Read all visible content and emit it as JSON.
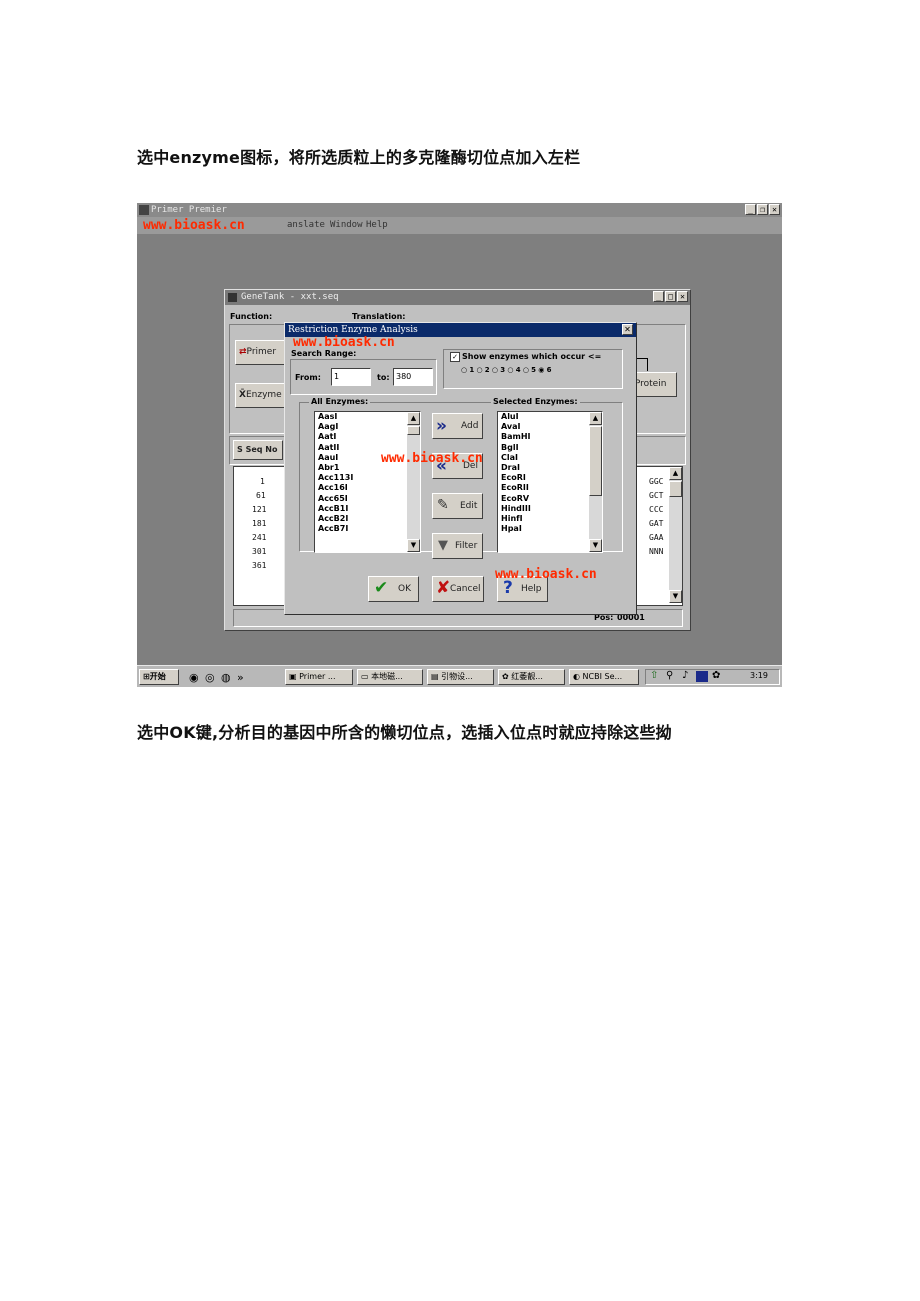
{
  "caption_top": "选中enzyme图标，将所选质粒上的多克隆酶切位点加入左栏",
  "caption_bottom": "选中OK键,分析目的基因中所含的懒切位点，选插入位点时就应持除这些拗",
  "watermark": "www.bioask.cn",
  "app": {
    "title": "Primer Premier",
    "menu": [
      "anslate",
      "Window",
      "Help"
    ]
  },
  "genetank": {
    "title": "GeneTank - xxt.seq",
    "function_label": "Function:",
    "translation_label": "Translation:",
    "primer_button": "Primer",
    "enzyme_button": "Enzyme",
    "protein_button": "Protein",
    "seq_button": "Seq No",
    "line_numbers": [
      "1",
      "61",
      "121",
      "181",
      "241",
      "301",
      "361"
    ],
    "seq_tails": [
      "GGC",
      "GCT",
      "CCC",
      "GAT",
      "GAA",
      "NNN"
    ],
    "pos_label": "Pos:",
    "pos_value": "00001"
  },
  "dialog": {
    "title": "Restriction Enzyme Analysis",
    "search_range_label": "Search Range:",
    "from_label": "From:",
    "from_value": "1",
    "to_label": "to:",
    "to_value": "380",
    "show_label": "Show enzymes which occur <=",
    "radio_options": [
      "1",
      "2",
      "3",
      "4",
      "5",
      "6"
    ],
    "radio_selected": "6",
    "all_label": "All Enzymes:",
    "selected_label": "Selected Enzymes:",
    "all_enzymes": [
      "AasI",
      "AagI",
      "AatI",
      "AatII",
      "AauI",
      "Abr1",
      "Acc113I",
      "Acc16I",
      "Acc65I",
      "AccB1I",
      "AccB2I",
      "AccB7I"
    ],
    "selected_enzymes": [
      "AluI",
      "AvaI",
      "BamHI",
      "BglI",
      "ClaI",
      "DraI",
      "EcoRI",
      "EcoRII",
      "EcoRV",
      "HindIII",
      "HinfI",
      "HpaI"
    ],
    "add_button": "Add",
    "del_button": "Del",
    "edit_button": "Edit",
    "filter_button": "Filter",
    "ok_button": "OK",
    "cancel_button": "Cancel",
    "help_button": "Help"
  },
  "taskbar": {
    "start": "开始",
    "tasks": [
      "Primer ...",
      "本地磁...",
      "引物设...",
      "红萎靓...",
      "NCBI Se..."
    ],
    "clock": "3:19"
  }
}
